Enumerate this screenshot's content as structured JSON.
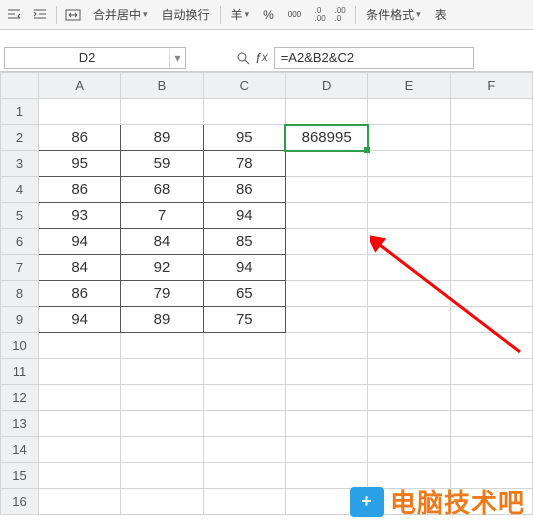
{
  "toolbar": {
    "merge_label": "合并居中",
    "wrap_label": "自动换行",
    "cond_format": "条件格式",
    "table_btn": "表"
  },
  "namebox": {
    "value": "D2"
  },
  "formula": {
    "value": "=A2&B2&C2"
  },
  "columns": [
    "A",
    "B",
    "C",
    "D",
    "E",
    "F"
  ],
  "rows": [
    "1",
    "2",
    "3",
    "4",
    "5",
    "6",
    "7",
    "8",
    "9",
    "10",
    "11",
    "12",
    "13",
    "14",
    "15",
    "16"
  ],
  "cells": {
    "A2": "86",
    "B2": "89",
    "C2": "95",
    "D2": "868995",
    "A3": "95",
    "B3": "59",
    "C3": "78",
    "A4": "86",
    "B4": "68",
    "C4": "86",
    "A5": "93",
    "B5": "7",
    "C5": "94",
    "A6": "94",
    "B6": "84",
    "C6": "85",
    "A7": "84",
    "B7": "92",
    "C7": "94",
    "A8": "86",
    "B8": "79",
    "C8": "65",
    "A9": "94",
    "B9": "89",
    "C9": "75"
  },
  "watermark": {
    "text": "电脑技术吧"
  }
}
